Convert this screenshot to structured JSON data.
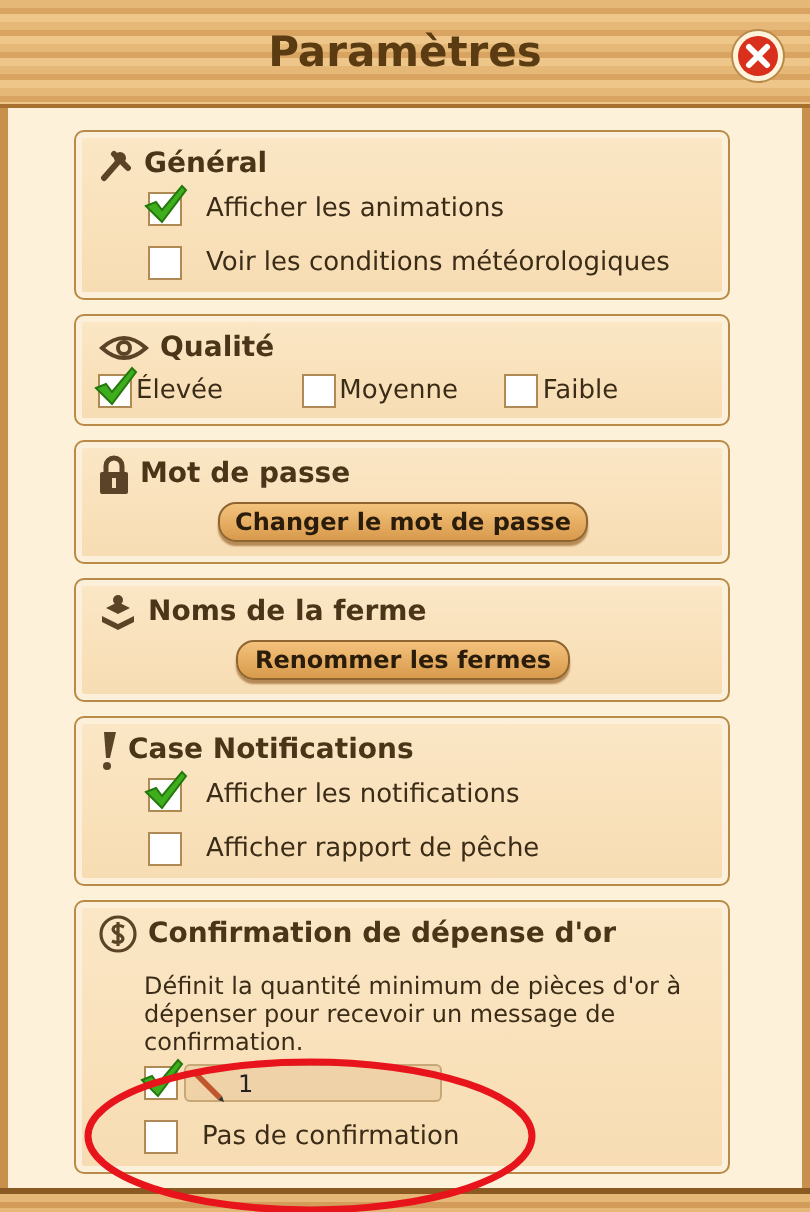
{
  "window": {
    "title": "Paramètres"
  },
  "sections": [
    {
      "kind": "checks",
      "title": "Général",
      "options": [
        {
          "label": "Afficher les animations",
          "checked": true
        },
        {
          "label": "Voir les conditions météorologiques",
          "checked": false
        }
      ]
    },
    {
      "kind": "inline",
      "title": "Qualité",
      "options": [
        {
          "label": "Élevée",
          "checked": true
        },
        {
          "label": "Moyenne",
          "checked": false
        },
        {
          "label": "Faible",
          "checked": false
        }
      ]
    },
    {
      "kind": "button",
      "title": "Mot de passe",
      "button": "Changer le mot de passe"
    },
    {
      "kind": "button",
      "title": "Noms de la ferme",
      "button": "Renommer les fermes"
    },
    {
      "kind": "checks",
      "title": "Case Notifications",
      "options": [
        {
          "label": "Afficher les notifications",
          "checked": true
        },
        {
          "label": "Afficher rapport de pêche",
          "checked": false
        }
      ]
    },
    {
      "kind": "gold",
      "title": "Confirmation de dépense d'or",
      "description": "Définit la quantité minimum de pièces d'or à dépenser pour recevoir un message de confirmation.",
      "amount": {
        "checked": true,
        "value": "1"
      },
      "options": [
        {
          "label": "Pas de confirmation",
          "checked": false
        }
      ]
    }
  ],
  "annotation": {
    "kind": "ellipse"
  }
}
